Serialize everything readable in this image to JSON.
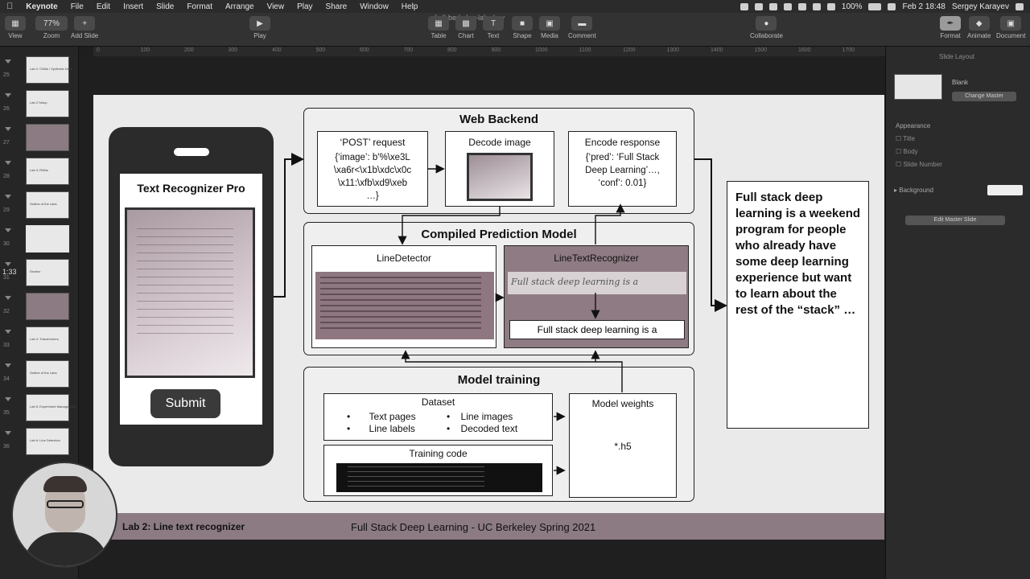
{
  "menubar": {
    "app": "Keynote",
    "items": [
      "File",
      "Edit",
      "Insert",
      "Slide",
      "Format",
      "Arrange",
      "View",
      "Play",
      "Share",
      "Window",
      "Help"
    ],
    "battery": "100%",
    "datetime": "Feb 2  18:48",
    "user": "Sergey Karayev"
  },
  "toolbar": {
    "doc_title": "fsdl-berkeley-labs.key",
    "view_label": "View",
    "zoom_value": "77%",
    "zoom_label": "Zoom",
    "add_slide_label": "Add Slide",
    "play_label": "Play",
    "table_label": "Table",
    "chart_label": "Chart",
    "text_label": "Text",
    "shape_label": "Shape",
    "media_label": "Media",
    "comment_label": "Comment",
    "collaborate_label": "Collaborate",
    "format_label": "Format",
    "animate_label": "Animate",
    "document_label": "Document"
  },
  "ruler": [
    "0",
    "100",
    "200",
    "300",
    "400",
    "500",
    "600",
    "700",
    "800",
    "900",
    "1000",
    "1100",
    "1200",
    "1300",
    "1400",
    "1500",
    "1600",
    "1700",
    "1800"
  ],
  "navigator": {
    "time": "1:33",
    "slides": [
      {
        "num": "25",
        "label": "Lab 2: CNNs / Synthetic Data",
        "dark": false
      },
      {
        "num": "26",
        "label": "Lab 2 Setup",
        "dark": false
      },
      {
        "num": "27",
        "label": "",
        "dark": true
      },
      {
        "num": "28",
        "label": "Lab 3: RNNs",
        "dark": false
      },
      {
        "num": "29",
        "label": "Outline of the Labs",
        "dark": false
      },
      {
        "num": "30",
        "label": "",
        "dark": false
      },
      {
        "num": "31",
        "label": "Section",
        "dark": false
      },
      {
        "num": "32",
        "label": "",
        "dark": true
      },
      {
        "num": "33",
        "label": "Lab 4: Transformers",
        "dark": false
      },
      {
        "num": "34",
        "label": "Outline of the Labs",
        "dark": false
      },
      {
        "num": "35",
        "label": "Lab 5: Experiment Management",
        "dark": false
      },
      {
        "num": "36",
        "label": "Lab 6: Line Detection",
        "dark": false
      }
    ]
  },
  "inspector": {
    "section": "Slide Layout",
    "layout_name": "Blank",
    "change_master": "Change Master",
    "appearance": "Appearance",
    "opt_title": "Title",
    "opt_body": "Body",
    "opt_slide_number": "Slide Number",
    "background": "Background",
    "edit_master": "Edit Master Slide"
  },
  "slide": {
    "phone": {
      "app_title": "Text Recognizer Pro",
      "submit": "Submit"
    },
    "web_backend": {
      "title": "Web Backend",
      "post_title": "‘POST’ request",
      "post_lines": [
        "{‘image’:  b'%\\xe3L",
        "\\xa6r<\\x1b\\xdc\\x0c",
        "\\x11:\\xfb\\xd9\\xeb",
        "…}"
      ],
      "decode_title": "Decode image",
      "encode_title": "Encode response",
      "encode_lines": [
        "{‘pred’:  ‘Full Stack",
        "Deep Learning’…,",
        "‘conf’: 0.01}"
      ]
    },
    "model": {
      "title": "Compiled Prediction Model",
      "line_detector": "LineDetector",
      "line_text_recognizer": "LineTextRecognizer",
      "handwriting": "Full stack deep learning is a",
      "output": "Full stack deep learning is a"
    },
    "training": {
      "title": "Model training",
      "dataset_title": "Dataset",
      "dataset_items": [
        "Text pages",
        "Line images",
        "Line labels",
        "Decoded text"
      ],
      "training_code_title": "Training code",
      "weights_title": "Model weights",
      "weights_file": "*.h5"
    },
    "output_text": "Full stack deep learning is a weekend program for people who already have some deep learning experience but want to learn about the rest of the “stack” …",
    "footer_left": "Lab 2: Line text recognizer",
    "footer_center": "Full Stack Deep Learning - UC Berkeley Spring 2021"
  }
}
